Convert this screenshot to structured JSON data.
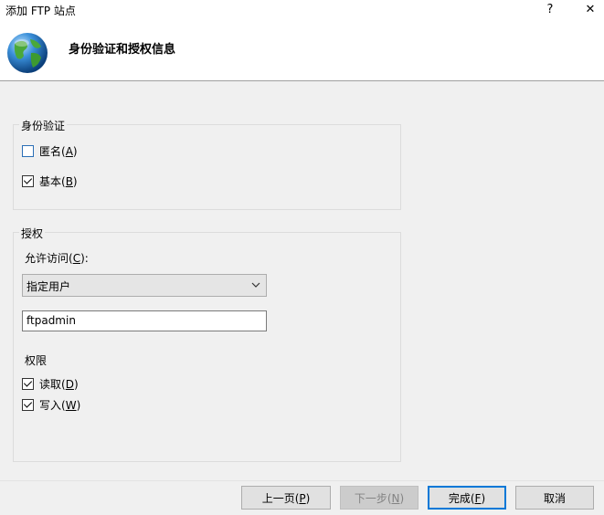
{
  "window": {
    "title": "添加 FTP 站点",
    "help_label": "?",
    "close_label": "✕"
  },
  "header": {
    "title": "身份验证和授权信息",
    "icon": "globe-icon"
  },
  "authentication": {
    "group_label": "身份验证",
    "anonymous": {
      "label_prefix": "匿名(",
      "access_key": "A",
      "label_suffix": ")",
      "checked": false
    },
    "basic": {
      "label_prefix": "基本(",
      "access_key": "B",
      "label_suffix": ")",
      "checked": true
    }
  },
  "authorization": {
    "group_label": "授权",
    "allow_access_label_prefix": "允许访问(",
    "allow_access_key": "C",
    "allow_access_label_suffix": "):",
    "allow_access_selected": "指定用户",
    "user_value": "ftpadmin",
    "permissions_label": "权限",
    "read": {
      "label_prefix": "读取(",
      "access_key": "D",
      "label_suffix": ")",
      "checked": true
    },
    "write": {
      "label_prefix": "写入(",
      "access_key": "W",
      "label_suffix": ")",
      "checked": true
    }
  },
  "buttons": {
    "previous": {
      "prefix": "上一页(",
      "key": "P",
      "suffix": ")"
    },
    "next": {
      "prefix": "下一步(",
      "key": "N",
      "suffix": ")"
    },
    "finish": {
      "prefix": "完成(",
      "key": "F",
      "suffix": ")"
    },
    "cancel": {
      "label": "取消"
    }
  },
  "colors": {
    "accent": "#0078d7",
    "window_bg": "#f0f0f0",
    "header_bg": "#ffffff"
  }
}
